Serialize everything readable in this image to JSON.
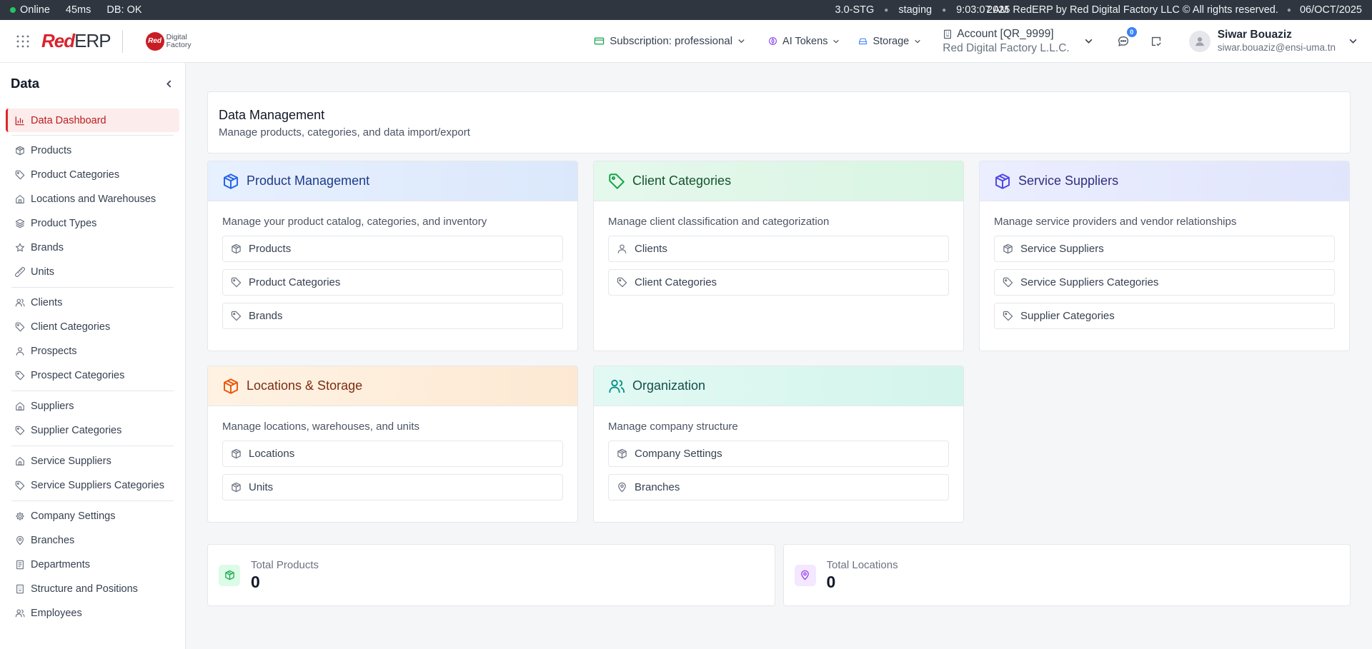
{
  "status_bar": {
    "online": "Online",
    "latency": "45ms",
    "db": "DB: OK",
    "version": "3.0-STG",
    "env": "staging",
    "time": "9:03:07 AM",
    "copyright": "2025 RedERP by Red Digital Factory LLC © All rights reserved.",
    "date": "06/OCT/2025"
  },
  "header": {
    "logo_red": "Red",
    "logo_erp": "ERP",
    "df_circle": "Red",
    "df_line1": "Digital",
    "df_line2": "Factory",
    "subscription": "Subscription: professional",
    "ai_tokens": "AI Tokens",
    "storage": "Storage",
    "account_title": "Account [QR_9999]",
    "account_company": "Red Digital Factory L.L.C.",
    "notification_count": "0",
    "user_name": "Siwar Bouaziz",
    "user_email": "siwar.bouaziz@ensi-uma.tn"
  },
  "sidebar": {
    "title": "Data",
    "active": "Data Dashboard",
    "group1": [
      "Products",
      "Product Categories",
      "Locations and Warehouses",
      "Product Types",
      "Brands",
      "Units"
    ],
    "group2": [
      "Clients",
      "Client Categories",
      "Prospects",
      "Prospect Categories"
    ],
    "group3": [
      "Suppliers",
      "Supplier Categories"
    ],
    "group4": [
      "Service Suppliers",
      "Service Suppliers Categories"
    ],
    "group5": [
      "Company Settings",
      "Branches",
      "Departments",
      "Structure and Positions",
      "Employees"
    ]
  },
  "main": {
    "title": "Data Management",
    "subtitle": "Manage products, categories, and data import/export",
    "cards": [
      {
        "title": "Product Management",
        "desc": "Manage your product catalog, categories, and inventory",
        "links": [
          "Products",
          "Product Categories",
          "Brands"
        ]
      },
      {
        "title": "Client Categories",
        "desc": "Manage client classification and categorization",
        "links": [
          "Clients",
          "Client Categories"
        ]
      },
      {
        "title": "Service Suppliers",
        "desc": "Manage service providers and vendor relationships",
        "links": [
          "Service Suppliers",
          "Service Suppliers Categories",
          "Supplier Categories"
        ]
      },
      {
        "title": "Locations & Storage",
        "desc": "Manage locations, warehouses, and units",
        "links": [
          "Locations",
          "Units"
        ]
      },
      {
        "title": "Organization",
        "desc": "Manage company structure",
        "links": [
          "Company Settings",
          "Branches"
        ]
      }
    ],
    "stats": [
      {
        "label": "Total Products",
        "value": "0"
      },
      {
        "label": "Total Locations",
        "value": "0"
      }
    ]
  },
  "colors": {
    "brand_red": "#d9232e",
    "active_bg": "#fdecec",
    "status_bar_bg": "#2f3640"
  }
}
